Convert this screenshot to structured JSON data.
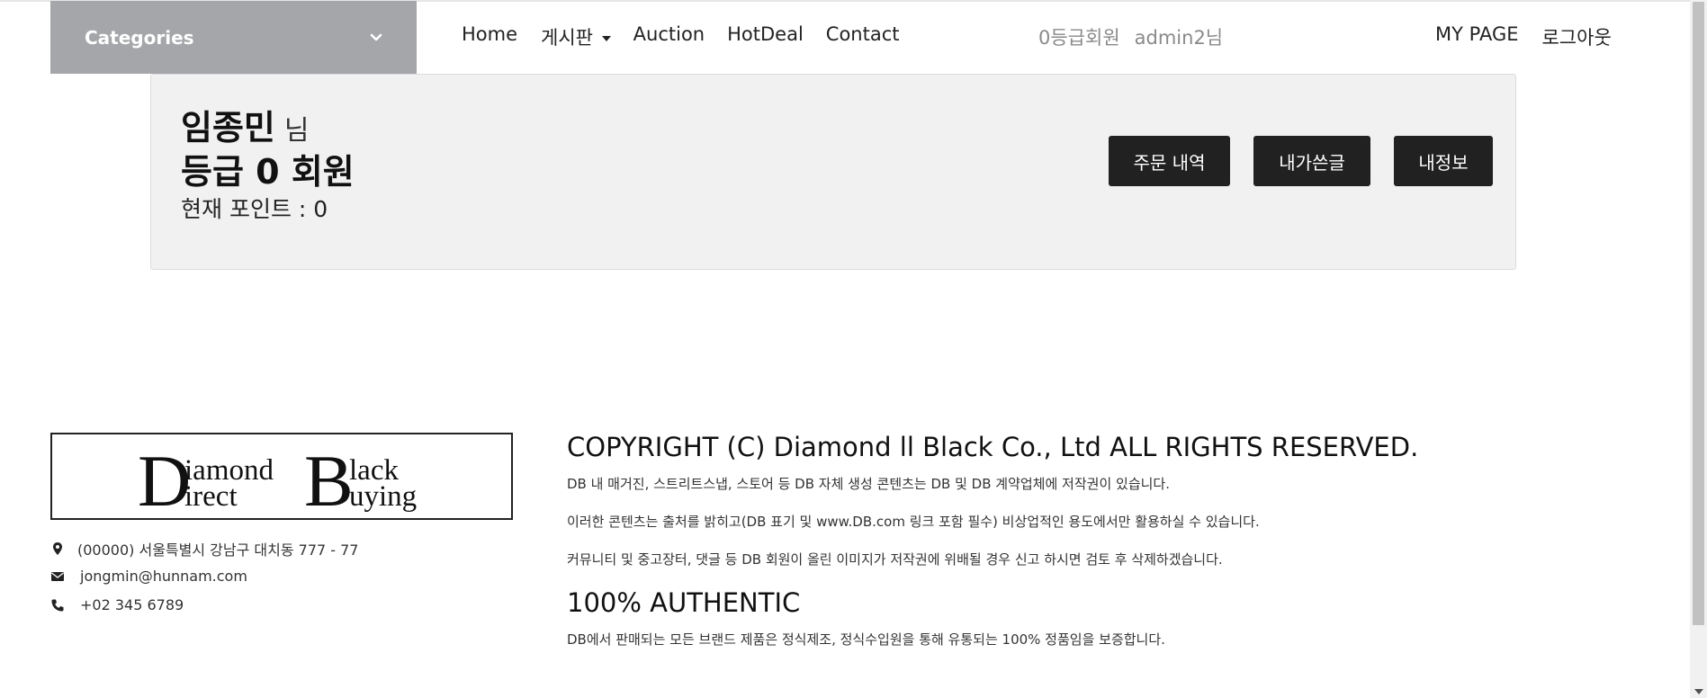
{
  "header": {
    "categories_label": "Categories",
    "nav": [
      {
        "label": "Home"
      },
      {
        "label": "게시판"
      },
      {
        "label": "Auction"
      },
      {
        "label": "HotDeal"
      },
      {
        "label": "Contact"
      }
    ],
    "user_grade": "0등급회원",
    "user_name": "admin2님",
    "mypage": "MY PAGE",
    "logout": "로그아웃"
  },
  "profile": {
    "name": "임종민",
    "name_suffix": "님",
    "grade": "등급 0 회원",
    "points": "현재 포인트 : 0",
    "buttons": {
      "orders": "주문 내역",
      "my_posts": "내가쓴글",
      "my_info": "내정보"
    }
  },
  "footer": {
    "logo": {
      "line1a": "iamond",
      "line1b": "lack",
      "line2a": "irect",
      "line2b": "uying",
      "cap1": "D",
      "cap2": "B"
    },
    "address": "(00000) 서울특별시 강남구 대치동 777 - 77",
    "email": "jongmin@hunnam.com",
    "phone": "+02 345 6789",
    "copyright_title": "COPYRIGHT (C) Diamond ll Black Co., Ltd ALL RIGHTS RESERVED.",
    "copyright_lines": [
      "DB 내 매거진, 스트리트스냅, 스토어 등 DB 자체 생성 콘텐츠는 DB 및 DB 계약업체에 저작권이 있습니다.",
      "이러한 콘텐츠는 출처를 밝히고(DB 표기 및 www.DB.com 링크 포함 필수) 비상업적인 용도에서만 활용하실 수 있습니다.",
      "커뮤니티 및 중고장터, 댓글 등 DB 회원이 올린 이미지가 저작권에 위배될 경우 신고 하시면 검토 후 삭제하겠습니다."
    ],
    "authentic_title": "100% AUTHENTIC",
    "authentic_text": "DB에서 판매되는 모든 브랜드 제품은 정식제조, 정식수입원을 통해 유통되는 100% 정품임을 보증합니다."
  }
}
